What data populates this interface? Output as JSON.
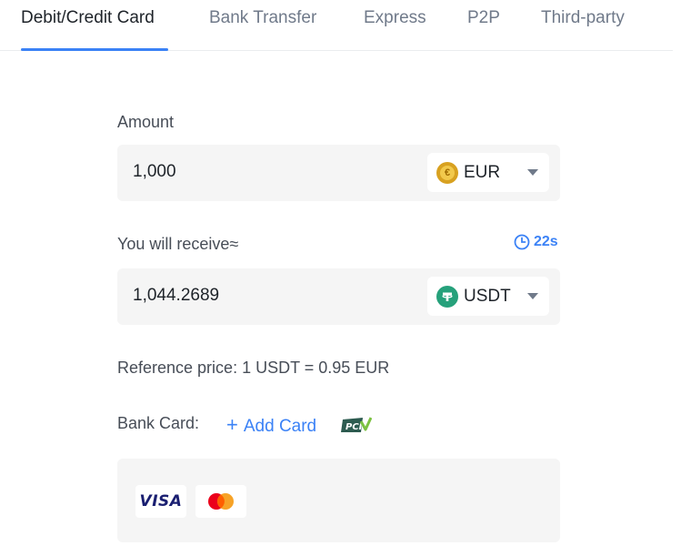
{
  "tabs": [
    {
      "label": "Debit/Credit Card",
      "active": true
    },
    {
      "label": "Bank Transfer",
      "active": false
    },
    {
      "label": "Express",
      "active": false
    },
    {
      "label": "P2P",
      "active": false
    },
    {
      "label": "Third-party",
      "active": false
    }
  ],
  "amount": {
    "label": "Amount",
    "value": "1,000",
    "currency": "EUR",
    "currency_icon": "euro-coin-icon"
  },
  "receive": {
    "label": "You will receive≈",
    "timer": "22s",
    "value": "1,044.2689",
    "currency": "USDT",
    "currency_icon": "tether-coin-icon"
  },
  "reference_price": "Reference price: 1 USDT = 0.95 EUR",
  "bank_card": {
    "label": "Bank Card:",
    "add_label": "Add Card",
    "pci_badge": "PCI"
  },
  "card_brands": [
    "VISA",
    "mastercard"
  ],
  "colors": {
    "accent": "#3b82f6",
    "field_bg": "#f5f5f5",
    "tether": "#26a17b",
    "euro": "#d8a120"
  }
}
